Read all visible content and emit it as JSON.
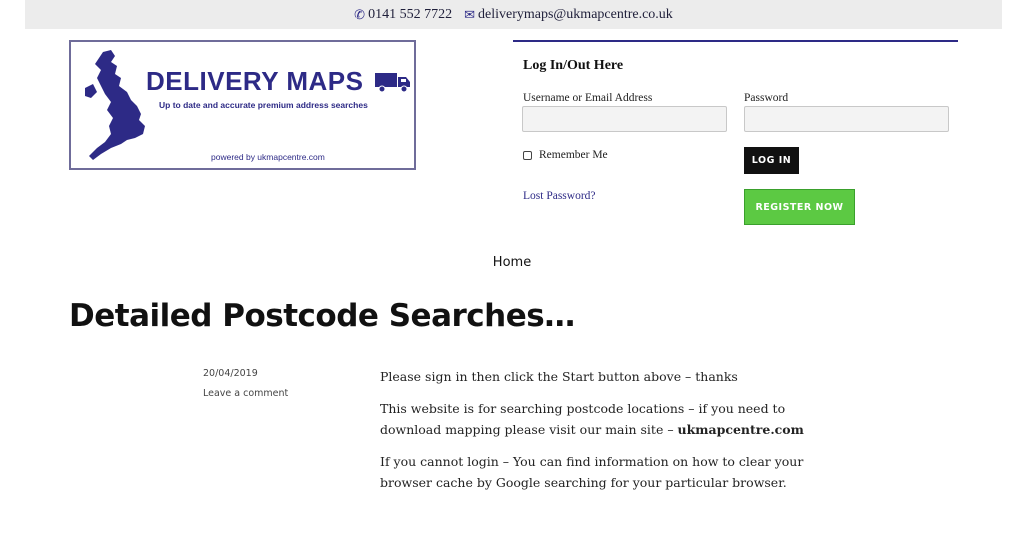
{
  "topbar": {
    "phone": "0141 552 7722",
    "email": "deliverymaps@ukmapcentre.co.uk",
    "phone_icon": "phone-icon",
    "email_icon": "envelope-icon"
  },
  "logo": {
    "brand": "DELIVERY MAPS",
    "tagline": "Up to date and accurate premium address searches",
    "powered": "powered by ukmapcentre.com",
    "color": "#2d2a86"
  },
  "login": {
    "heading": "Log In/Out Here",
    "username_label": "Username or Email Address",
    "password_label": "Password",
    "remember_label": "Remember Me",
    "login_button": "LOG IN",
    "lost_password": "Lost Password?",
    "register_button": "REGISTER NOW"
  },
  "nav": {
    "home": "Home"
  },
  "post": {
    "title": "Detailed Postcode Searches…",
    "date": "20/04/2019",
    "comment_link": "Leave a comment",
    "para1": "Please sign in then click the Start button above – thanks",
    "para2_prefix": "This website is for searching postcode locations – if you need to download mapping please visit our main site – ",
    "para2_link": "ukmapcentre.com",
    "para3": "If you cannot login – You can find information on how to clear your browser cache by Google searching for your particular browser."
  },
  "colors": {
    "accent": "#2d2a86",
    "register_green": "#5cc943",
    "topbar_bg": "#ececec"
  }
}
